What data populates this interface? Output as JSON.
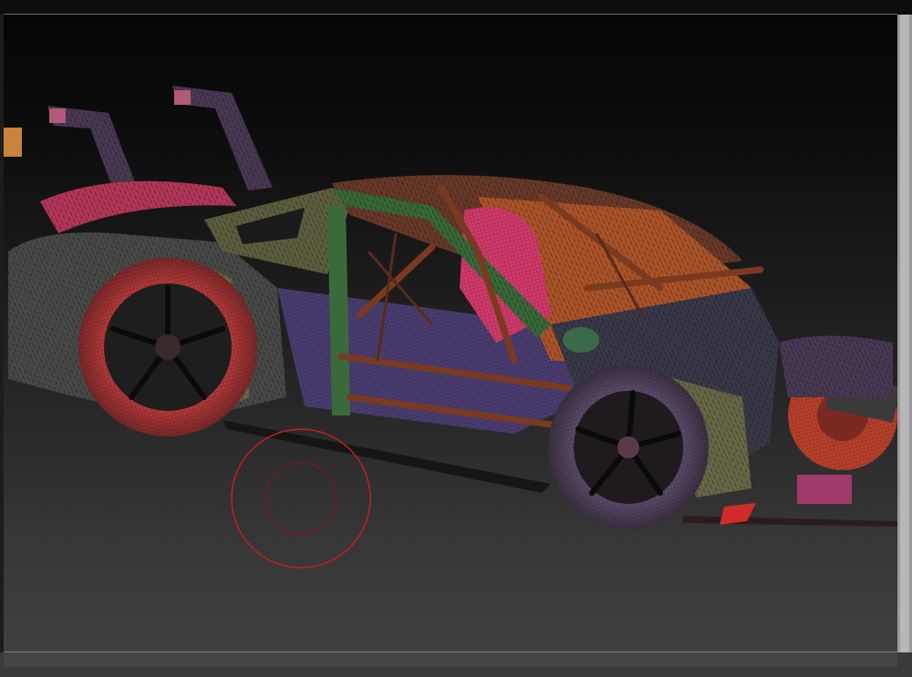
{
  "app": {
    "kind": "3d-sculpt-viewport"
  },
  "viewport": {
    "model": "wireframe-race-car",
    "display_mode": "polyframe",
    "background_top_color": "#050505",
    "background_bottom_color": "#404040"
  },
  "brush": {
    "outer_ring_color": "#c41e1e",
    "inner_ring_color": "#8a1616"
  },
  "colors": {
    "tire_red": "#b83a3a",
    "cage_orange": "#a0522d",
    "body_olive": "#5a5a3a",
    "body_purple": "#4a3a6a",
    "interior_pink": "#d13a6a",
    "wire": "#0a0a0a"
  }
}
